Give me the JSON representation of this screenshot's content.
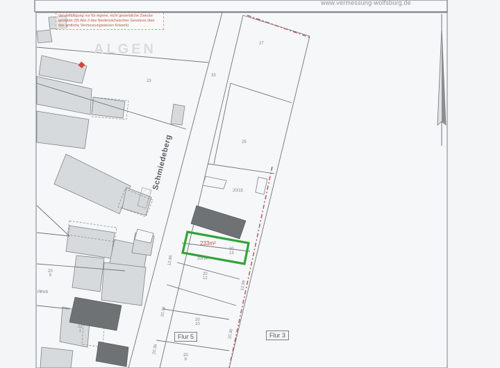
{
  "header": {
    "url": "www.vermessung-wolfsburg.de",
    "usage_note": "Vervielfältigung nur für eigene, nicht gewerbliche Zwecke gestattet (§5 Abs.3 des Niedersächsischen Gesetzes über das amtliche Vermessungswesen Kriwerk)"
  },
  "map": {
    "street_name": "Schmiedeberg",
    "background_lettering": "ALGEN",
    "plots": {
      "p27": "27",
      "p33": "33",
      "p23": "23",
      "p25": "25",
      "p20_9": [
        "20",
        "9"
      ],
      "p22_1": [
        "22",
        "1"
      ],
      "p20_12": [
        "20",
        "12"
      ],
      "p20_10": [
        "20",
        "10"
      ],
      "p20_8": [
        "20",
        "8"
      ],
      "p20_14": "20/14",
      "p20_13": [
        "20",
        "13"
      ],
      "p20_15": "20/15",
      "p20_16": [
        "20",
        "16"
      ]
    },
    "small_numbers": [
      "12.96",
      "12.96",
      "20.36",
      "20.36",
      "20.36"
    ],
    "edge_text": "rleus",
    "flur_labels": [
      "Flur 5",
      "Flur 3"
    ],
    "highlight_area": "233m²",
    "highlight_color": "#33a33a",
    "parcel_boundary_color": "#b0505a"
  }
}
